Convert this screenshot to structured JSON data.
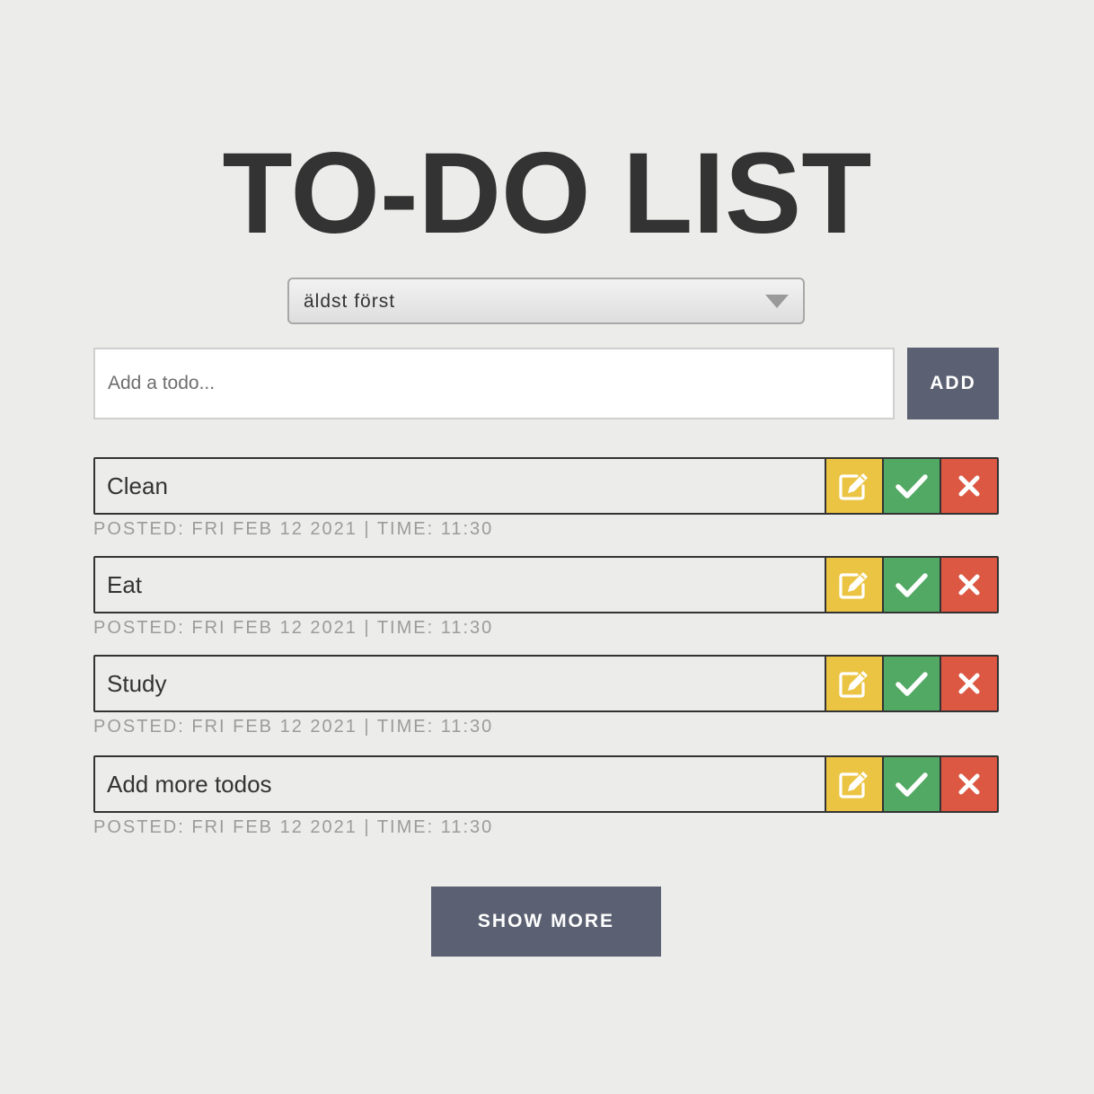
{
  "page": {
    "title": "TO-DO LIST"
  },
  "sort": {
    "selected": "äldst först"
  },
  "new_todo": {
    "placeholder": "Add a todo...",
    "value": "",
    "add_label": "ADD"
  },
  "todos": [
    {
      "text": "Clean",
      "meta": "POSTED: FRI FEB 12 2021 | TIME: 11:30"
    },
    {
      "text": "Eat",
      "meta": "POSTED: FRI FEB 12 2021 | TIME: 11:30"
    },
    {
      "text": "Study",
      "meta": "POSTED: FRI FEB 12 2021 | TIME: 11:30"
    },
    {
      "text": "Add more todos",
      "meta": "POSTED: FRI FEB 12 2021 | TIME: 11:30"
    }
  ],
  "actions": {
    "edit_icon": "edit-icon",
    "done_icon": "check-icon",
    "delete_icon": "close-icon"
  },
  "show_more": {
    "label": "SHOW MORE"
  },
  "colors": {
    "background": "#ececea",
    "text": "#333333",
    "button": "#5b6172",
    "edit": "#ebc443",
    "done": "#52a964",
    "delete": "#dc5843",
    "meta": "#9b9b9b"
  }
}
